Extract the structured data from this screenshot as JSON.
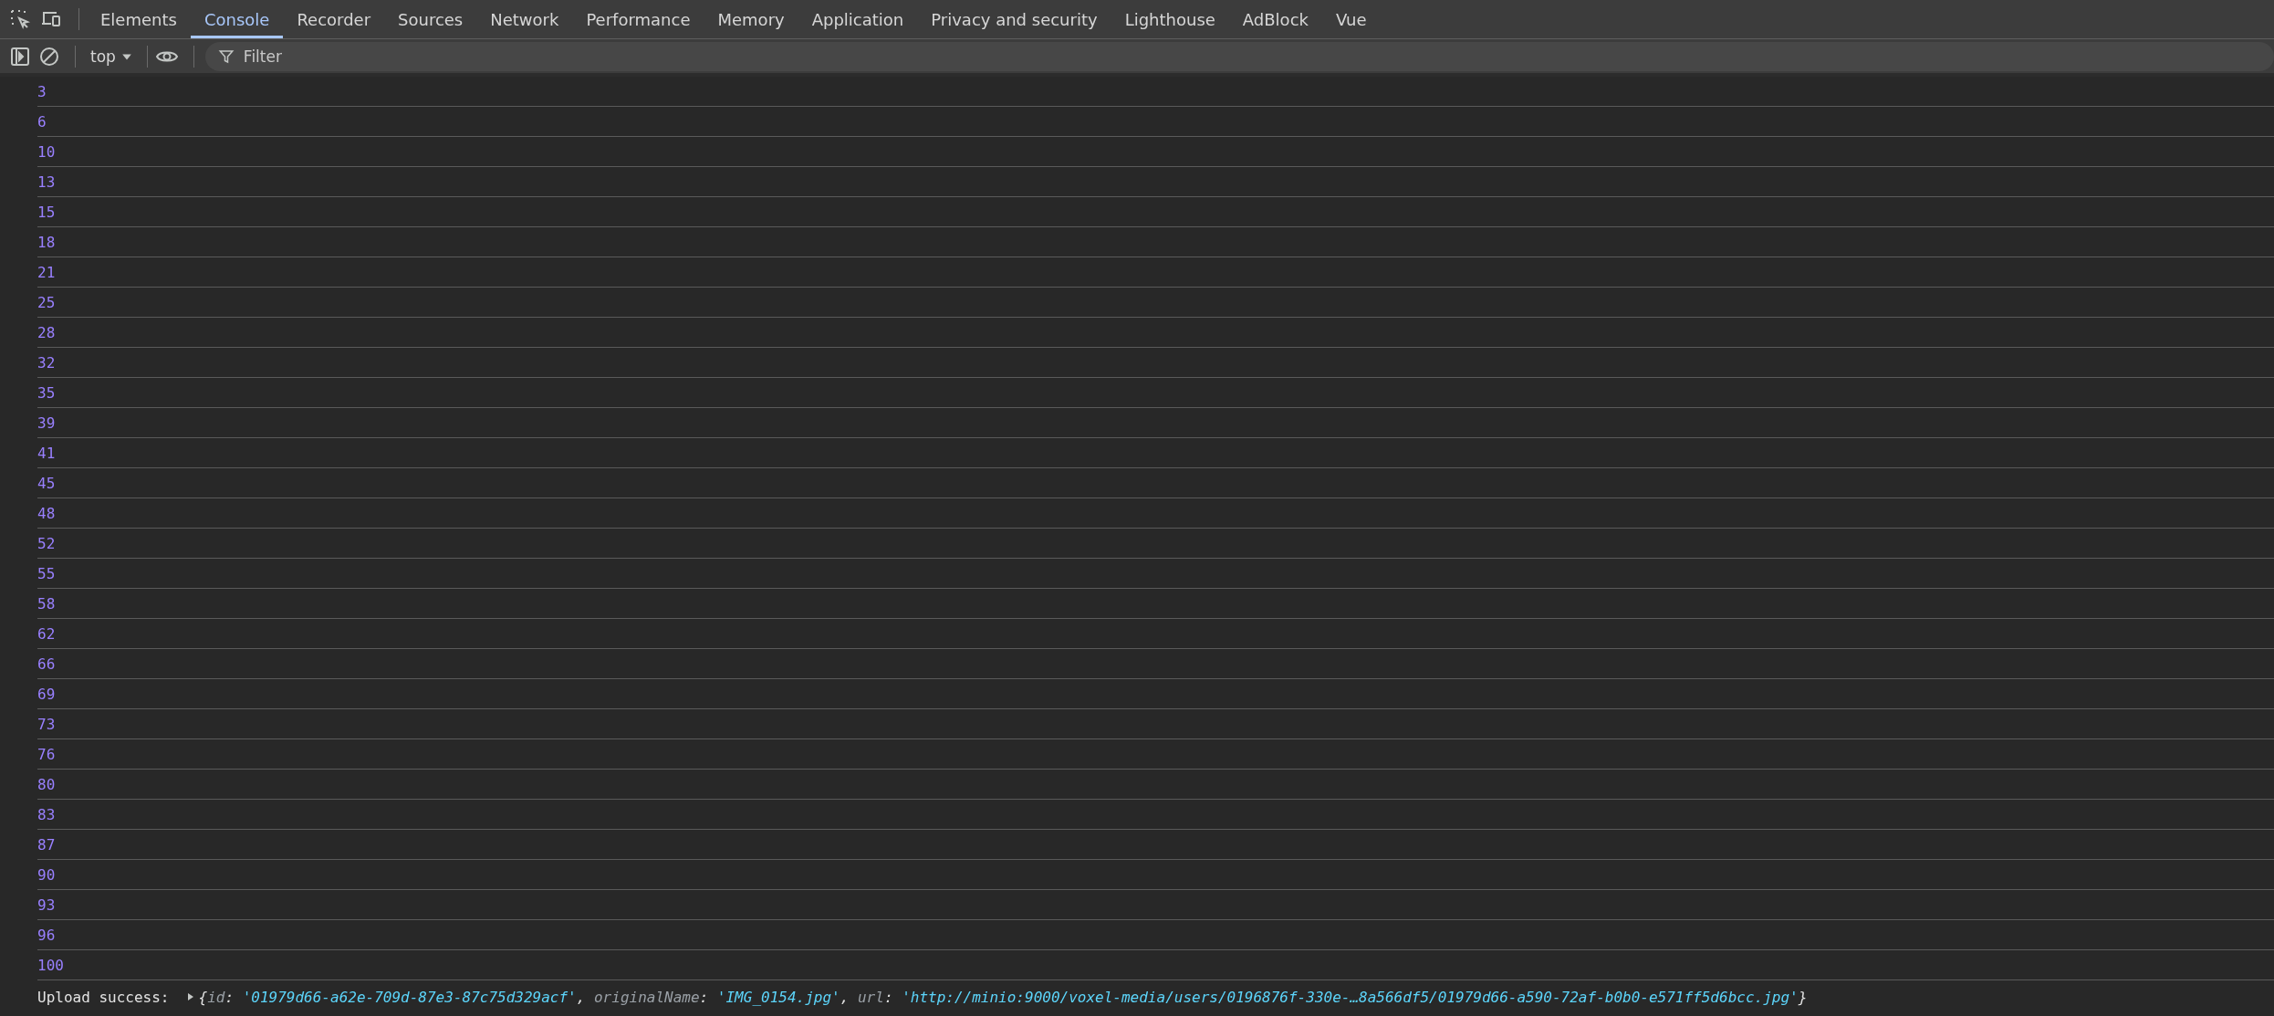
{
  "tabs": [
    {
      "label": "Elements",
      "selected": false
    },
    {
      "label": "Console",
      "selected": true
    },
    {
      "label": "Recorder",
      "selected": false
    },
    {
      "label": "Sources",
      "selected": false
    },
    {
      "label": "Network",
      "selected": false
    },
    {
      "label": "Performance",
      "selected": false
    },
    {
      "label": "Memory",
      "selected": false
    },
    {
      "label": "Application",
      "selected": false
    },
    {
      "label": "Privacy and security",
      "selected": false
    },
    {
      "label": "Lighthouse",
      "selected": false
    },
    {
      "label": "AdBlock",
      "selected": false
    },
    {
      "label": "Vue",
      "selected": false
    }
  ],
  "toolbar": {
    "context": "top",
    "filter": {
      "placeholder": "Filter"
    }
  },
  "console": {
    "messages": [
      {
        "kind": "number",
        "text": "3"
      },
      {
        "kind": "number",
        "text": "6"
      },
      {
        "kind": "number",
        "text": "10"
      },
      {
        "kind": "number",
        "text": "13"
      },
      {
        "kind": "number",
        "text": "15"
      },
      {
        "kind": "number",
        "text": "18"
      },
      {
        "kind": "number",
        "text": "21"
      },
      {
        "kind": "number",
        "text": "25"
      },
      {
        "kind": "number",
        "text": "28"
      },
      {
        "kind": "number",
        "text": "32"
      },
      {
        "kind": "number",
        "text": "35"
      },
      {
        "kind": "number",
        "text": "39"
      },
      {
        "kind": "number",
        "text": "41"
      },
      {
        "kind": "number",
        "text": "45"
      },
      {
        "kind": "number",
        "text": "48"
      },
      {
        "kind": "number",
        "text": "52"
      },
      {
        "kind": "number",
        "text": "55"
      },
      {
        "kind": "number",
        "text": "58"
      },
      {
        "kind": "number",
        "text": "62"
      },
      {
        "kind": "number",
        "text": "66"
      },
      {
        "kind": "number",
        "text": "69"
      },
      {
        "kind": "number",
        "text": "73"
      },
      {
        "kind": "number",
        "text": "76"
      },
      {
        "kind": "number",
        "text": "80"
      },
      {
        "kind": "number",
        "text": "83"
      },
      {
        "kind": "number",
        "text": "87"
      },
      {
        "kind": "number",
        "text": "90"
      },
      {
        "kind": "number",
        "text": "93"
      },
      {
        "kind": "number",
        "text": "96"
      },
      {
        "kind": "number",
        "text": "100"
      },
      {
        "kind": "object",
        "text": "Upload success:",
        "expanded": false,
        "open": "{",
        "close": "}",
        "properties": [
          {
            "key": "id",
            "colon": ":",
            "value": "'01979d66-a62e-709d-87e3-87c75d329acf'",
            "comma": ","
          },
          {
            "key": "originalName",
            "colon": ":",
            "value": "'IMG_0154.jpg'",
            "comma": ","
          },
          {
            "key": "url",
            "colon": ":",
            "value": "'http://minio:9000/voxel-media/users/0196876f-330e-…8a566df5/01979d66-a590-72af-b0b0-e571ff5d6bcc.jpg'"
          }
        ]
      }
    ]
  }
}
